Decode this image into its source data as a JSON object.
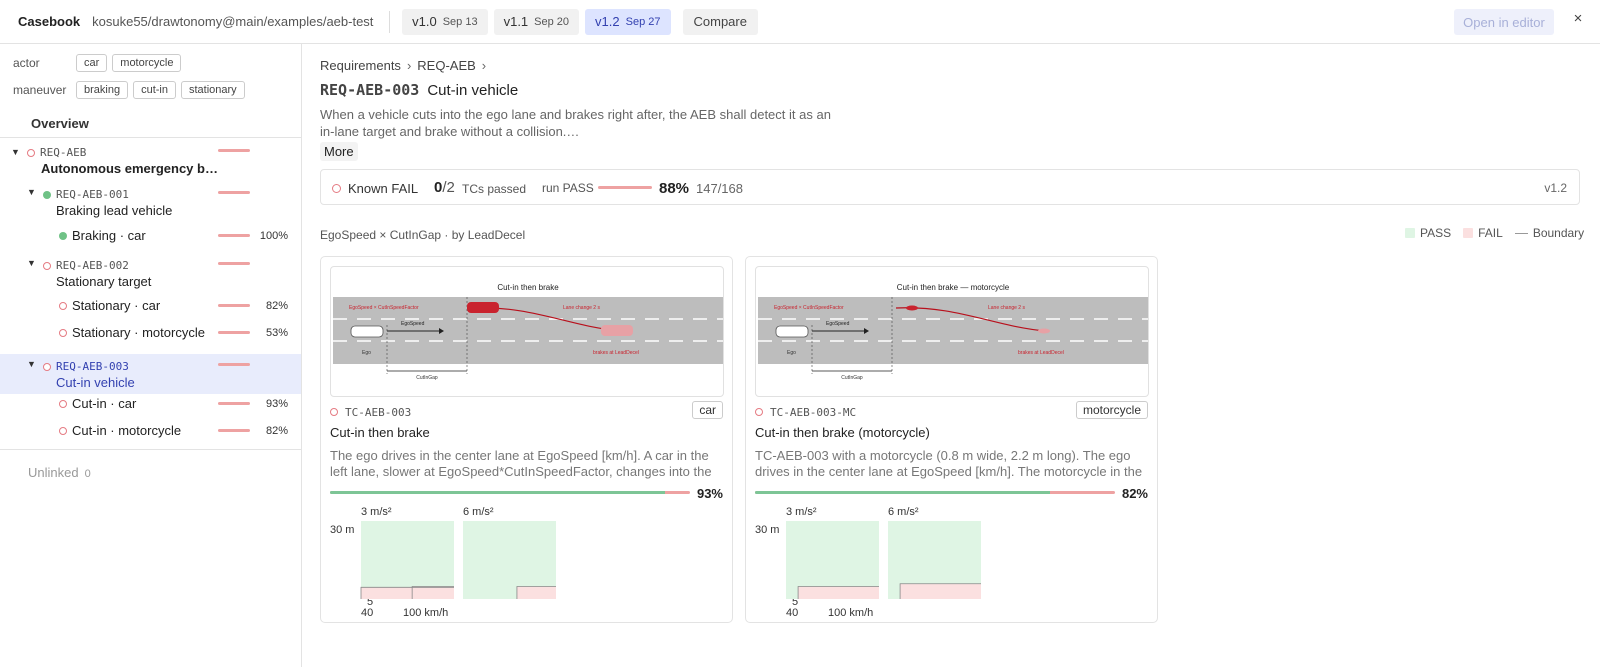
{
  "topbar": {
    "brand": "Casebook",
    "repo": "kosuke55/drawtonomy@main/examples/aeb-test",
    "versions": [
      {
        "label": "v1.0",
        "date": "Sep 13",
        "active": false
      },
      {
        "label": "v1.1",
        "date": "Sep 20",
        "active": false
      },
      {
        "label": "v1.2",
        "date": "Sep 27",
        "active": true
      }
    ],
    "compare": "Compare",
    "open_editor": "Open in editor",
    "close": "×"
  },
  "filters": {
    "actor_label": "actor",
    "actor_tags": [
      "car",
      "motorcycle"
    ],
    "maneuver_label": "maneuver",
    "maneuver_tags": [
      "braking",
      "cut-in",
      "stationary"
    ]
  },
  "sidebar": {
    "overview": "Overview",
    "root": {
      "id": "REQ-AEB",
      "title": "Autonomous emergency b…",
      "pass": 0.9,
      "status": "fail"
    },
    "groups": [
      {
        "id": "REQ-AEB-001",
        "title": "Braking lead vehicle",
        "pass": 1.0,
        "status": "ok",
        "tests": [
          {
            "label": "Braking · car",
            "pct": "100%",
            "pass": 1.0,
            "status": "ok"
          }
        ]
      },
      {
        "id": "REQ-AEB-002",
        "title": "Stationary target",
        "pass": 0.7,
        "status": "fail",
        "tests": [
          {
            "label": "Stationary · car",
            "pct": "82%",
            "pass": 0.82,
            "status": "fail"
          },
          {
            "label": "Stationary · motorcycle",
            "pct": "53%",
            "pass": 0.53,
            "status": "fail"
          }
        ]
      },
      {
        "id": "REQ-AEB-003",
        "title": "Cut-in vehicle",
        "pass": 0.88,
        "status": "fail",
        "selected": true,
        "tests": [
          {
            "label": "Cut-in · car",
            "pct": "93%",
            "pass": 0.93,
            "status": "fail"
          },
          {
            "label": "Cut-in · motorcycle",
            "pct": "82%",
            "pass": 0.82,
            "status": "fail"
          }
        ]
      }
    ],
    "unlinked_label": "Unlinked",
    "unlinked_count": "0"
  },
  "main": {
    "breadcrumb": [
      "Requirements",
      "REQ-AEB"
    ],
    "req_id": "REQ-AEB-003",
    "req_title": "Cut-in vehicle",
    "description_line1": "When a vehicle cuts into the ego lane and brakes right after, the AEB shall detect it as an",
    "description_line2": "in-lane target and brake without a collision.…",
    "more": "More",
    "status": {
      "known": "Known FAIL",
      "passed": "0",
      "total": "/2",
      "tcs_label": "TCs passed",
      "run_label": "run PASS",
      "run_pass": 0.88,
      "run_pct": "88%",
      "run_count": "147/168",
      "version": "v1.2"
    },
    "grid_label": "EgoSpeed × CutInGap · by LeadDecel",
    "legend": {
      "pass": "PASS",
      "fail": "FAIL",
      "boundary": "Boundary"
    },
    "colors": {
      "pass": "#dff5e4",
      "fail": "#fbe0e0",
      "bar_pass": "#7dc596",
      "bar_fail": "#eea2a2",
      "accent": "#3341b0"
    },
    "cards": [
      {
        "id": "TC-AEB-003",
        "tag": "car",
        "title": "Cut-in then brake",
        "description": "The ego drives in the center lane at EgoSpeed [km/h]. A car in the left lane, slower at EgoSpeed*CutInSpeedFactor, changes into the ego lane and brakes at LeadDecel.",
        "pass": 0.93,
        "pct": "93%",
        "diagram": {
          "title": "Cut-in then brake",
          "ego_speed_label": "EgoSpeed × CutInSpeedFactor",
          "ego_label": "EgoSpeed",
          "lane_change": "Lane change 2 s",
          "ego": "Ego",
          "brakes": "brakes at LeadDecel",
          "gap": "CutInGap",
          "target": "car"
        },
        "heatmap": {
          "ylabel_top": "30 m",
          "ylabel_bottom": "5",
          "xlabel_left": "40",
          "xlabel_right": "100 km/h",
          "panels": [
            {
              "label": "3 m/s²",
              "fail_steps": [
                [
                  0.55,
                  1.0
                ],
                [
                  0.0,
                  0.55
                ]
              ]
            },
            {
              "label": "6 m/s²",
              "fail_steps": [
                [
                  0.58,
                  1.0
                ]
              ]
            }
          ]
        }
      },
      {
        "id": "TC-AEB-003-MC",
        "tag": "motorcycle",
        "title": "Cut-in then brake (motorcycle)",
        "description": "TC-AEB-003 with a motorcycle (0.8 m wide, 2.2 m long). The ego drives in the center lane at EgoSpeed [km/h]. The motorcycle in the left lane cuts in and brakes.",
        "pass": 0.82,
        "pct": "82%",
        "diagram": {
          "title": "Cut-in then brake — motorcycle",
          "ego_speed_label": "EgoSpeed × CutInSpeedFactor",
          "ego_label": "EgoSpeed",
          "lane_change": "Lane change 2 s",
          "ego": "Ego",
          "brakes": "brakes at LeadDecel",
          "gap": "CutInGap",
          "target": "motorcycle"
        },
        "heatmap": {
          "ylabel_top": "30 m",
          "ylabel_bottom": "5",
          "xlabel_left": "40",
          "xlabel_right": "100 km/h",
          "panels": [
            {
              "label": "3 m/s²",
              "fail_steps": [
                [
                  0.13,
                  1.0
                ]
              ]
            },
            {
              "label": "6 m/s²",
              "fail_steps": [
                [
                  0.13,
                  0.72
                ]
              ]
            }
          ]
        }
      }
    ]
  }
}
